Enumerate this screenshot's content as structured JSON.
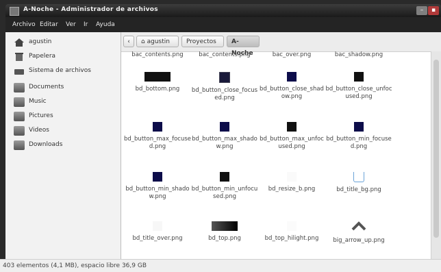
{
  "window": {
    "title": "A-Noche - Administrador de archivos"
  },
  "menu": [
    "Archivo",
    "Editar",
    "Ver",
    "Ir",
    "Ayuda"
  ],
  "sidebar": {
    "items": [
      {
        "label": "agustin",
        "icon": "home-icon"
      },
      {
        "label": "Papelera",
        "icon": "trash-icon"
      },
      {
        "label": "Sistema de archivos",
        "icon": "drive-icon"
      },
      {
        "label": "Documents",
        "icon": "folder-icon"
      },
      {
        "label": "Music",
        "icon": "folder-icon"
      },
      {
        "label": "Pictures",
        "icon": "folder-icon"
      },
      {
        "label": "Videos",
        "icon": "folder-icon"
      },
      {
        "label": "Downloads",
        "icon": "folder-icon"
      }
    ]
  },
  "pathbar": {
    "segments": [
      "agustin",
      "Proyectos",
      "A-Noche"
    ]
  },
  "files": {
    "top_partial": [
      "bac_contents.png",
      "bac_contents.png",
      "bac_over.png",
      "bac_shadow.png"
    ],
    "items": [
      {
        "name": "bd_bottom.png"
      },
      {
        "name": "bd_button_close_focused.png"
      },
      {
        "name": "bd_button_close_shadow.png"
      },
      {
        "name": "bd_button_close_unfocused.png"
      },
      {
        "name": "bd_button_max_focused.png"
      },
      {
        "name": "bd_button_max_shadow.png"
      },
      {
        "name": "bd_button_max_unfocused.png"
      },
      {
        "name": "bd_button_min_focused.png"
      },
      {
        "name": "bd_button_min_shadow.png"
      },
      {
        "name": "bd_button_min_unfocused.png"
      },
      {
        "name": "bd_resize_b.png"
      },
      {
        "name": "bd_title_bg.png"
      },
      {
        "name": "bd_title_over.png"
      },
      {
        "name": "bd_top.png"
      },
      {
        "name": "bd_top_hilight.png"
      },
      {
        "name": "big_arrow_up.png"
      }
    ]
  },
  "status": {
    "text": "403 elementos (4,1 MB), espacio libre 36,9 GB"
  }
}
